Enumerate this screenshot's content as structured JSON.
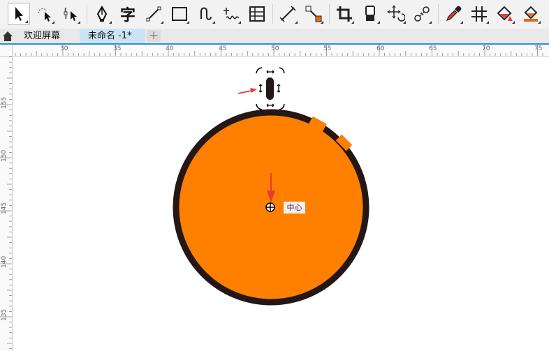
{
  "toolbar": {
    "tools": [
      {
        "name": "pick-tool-icon",
        "active": true
      },
      {
        "name": "freehand-pick-tool-icon"
      },
      {
        "name": "shape-tool-icon"
      },
      {
        "name": "pen-tool-icon"
      },
      {
        "name": "text-tool-icon",
        "glyph": "字"
      },
      {
        "name": "line-tool-icon"
      },
      {
        "name": "rectangle-tool-icon"
      },
      {
        "name": "spiral-tool-icon"
      },
      {
        "name": "bezier-tool-icon"
      },
      {
        "name": "table-tool-icon"
      },
      {
        "name": "dimension-tool-icon"
      },
      {
        "name": "connector-tool-icon"
      },
      {
        "name": "crop-tool-icon"
      },
      {
        "name": "eraser-tool-icon"
      },
      {
        "name": "transform-tool-icon"
      },
      {
        "name": "blend-tool-icon"
      },
      {
        "name": "eyedropper-tool-icon"
      },
      {
        "name": "guideline-tool-icon"
      },
      {
        "name": "fill-tool-icon"
      },
      {
        "name": "smart-fill-tool-icon"
      }
    ]
  },
  "tabs": {
    "welcome": "欢迎屏幕",
    "document": "未命名 -1*",
    "add": "+"
  },
  "ruler": {
    "horizontal": [
      "30",
      "35",
      "40",
      "45",
      "50",
      "55",
      "60",
      "65",
      "70",
      "75"
    ],
    "vertical": [
      "155",
      "150",
      "145",
      "140",
      "135"
    ]
  },
  "canvas": {
    "center_label": "中心",
    "circle_fill": "#ff7f00",
    "circle_stroke": "#231815",
    "arrow_color": "#e8383d",
    "accent": "#2f8fd8"
  }
}
